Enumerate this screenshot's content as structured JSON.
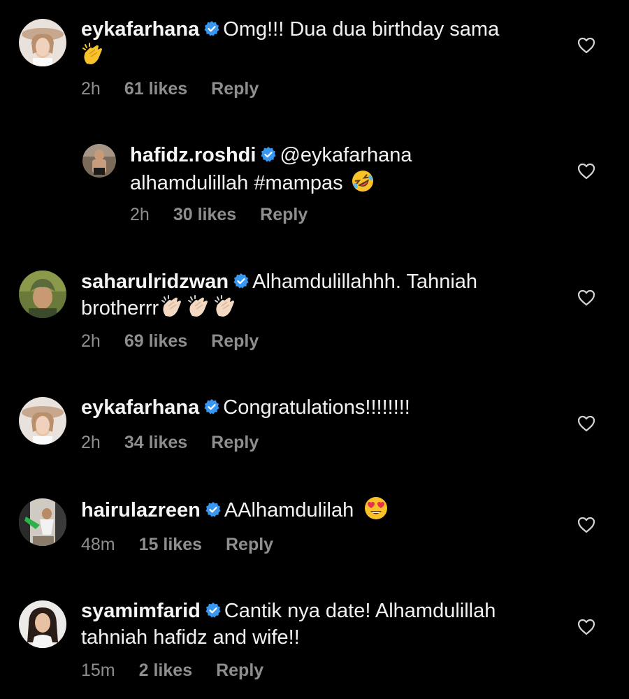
{
  "comments": [
    {
      "username": "eykafarhana",
      "line1": "Omg!!! Dua dua birthday sama",
      "line2": "",
      "emoji": "clapping-hands",
      "time": "2h",
      "likes": "61 likes",
      "reply": "Reply"
    },
    {
      "username": "hafidz.roshdi",
      "line1": "@eykafarhana",
      "line2": "alhamdulillah #mampas",
      "emoji": "rolling-laughing-face",
      "time": "2h",
      "likes": "30 likes",
      "reply": "Reply"
    },
    {
      "username": "saharulridzwan",
      "line1": "Alhamdulillahhh. Tahniah",
      "line2": "brotherrr",
      "emoji": "clapping-hands-light-x3",
      "time": "2h",
      "likes": "69 likes",
      "reply": "Reply"
    },
    {
      "username": "eykafarhana",
      "line1": "Congratulations!!!!!!!!",
      "line2": "",
      "emoji": "",
      "time": "2h",
      "likes": "34 likes",
      "reply": "Reply"
    },
    {
      "username": "hairulazreen",
      "line1": "AAlhamdulilah",
      "line2": "",
      "emoji": "heart-eyes-face",
      "time": "48m",
      "likes": "15 likes",
      "reply": "Reply"
    },
    {
      "username": "syamimfarid",
      "line1": "Cantik nya date! Alhamdulillah",
      "line2": "tahniah hafidz and wife!!",
      "emoji": "",
      "time": "15m",
      "likes": "2 likes",
      "reply": "Reply"
    }
  ],
  "colors": {
    "background": "#000000",
    "text": "#f2f2f2",
    "meta": "#8e8e8e",
    "verified": "#3897f0"
  }
}
